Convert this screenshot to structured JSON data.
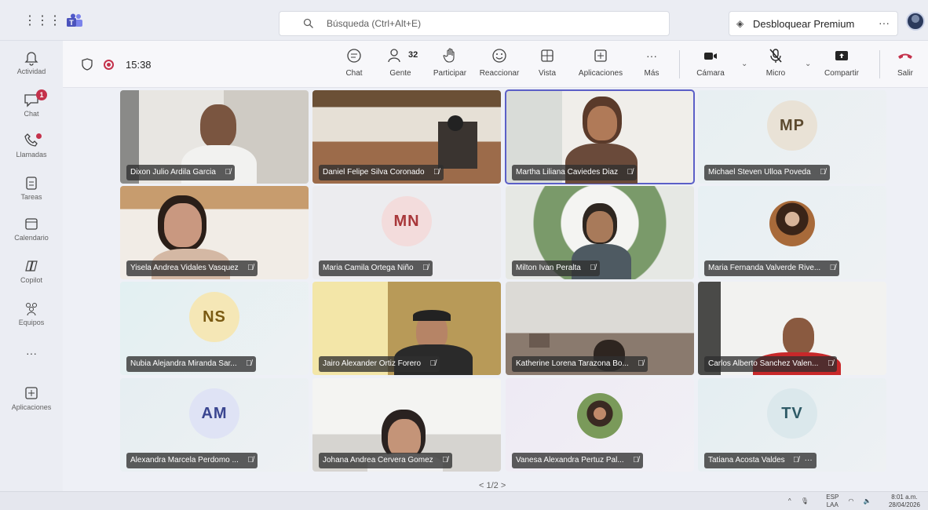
{
  "search": {
    "placeholder": "Búsqueda (Ctrl+Alt+E)"
  },
  "premium": {
    "label": "Desbloquear Premium",
    "more": "···"
  },
  "rail": [
    {
      "label": "Actividad",
      "icon": "bell-icon"
    },
    {
      "label": "Chat",
      "icon": "chat-icon",
      "badge": "1"
    },
    {
      "label": "Llamadas",
      "icon": "phone-icon",
      "dot": true
    },
    {
      "label": "Tareas",
      "icon": "tasks-icon"
    },
    {
      "label": "Calendario",
      "icon": "calendar-icon"
    },
    {
      "label": "Copilot",
      "icon": "copilot-icon"
    },
    {
      "label": "Equipos",
      "icon": "teams-icon"
    },
    {
      "label": "···",
      "icon": "more-icon"
    },
    {
      "label": "Aplicaciones",
      "icon": "add-app-icon"
    }
  ],
  "meeting": {
    "time": "15:38",
    "participants_count": "32",
    "toolbar": {
      "chat": "Chat",
      "people": "Gente",
      "raise": "Participar",
      "react": "Reaccionar",
      "view": "Vista",
      "apps": "Aplicaciones",
      "more": "Más",
      "camera": "Cámara",
      "mic": "Micro",
      "share": "Compartir",
      "leave": "Salir"
    }
  },
  "tiles": [
    {
      "name": "Dixon Julio Ardila Garcia",
      "type": "video"
    },
    {
      "name": "Daniel Felipe Silva Coronado",
      "type": "video"
    },
    {
      "name": "Martha Liliana Caviedes Diaz",
      "type": "video",
      "speaking": true
    },
    {
      "name": "Michael Steven Ulloa Poveda",
      "type": "initials",
      "initials": "MP"
    },
    {
      "name": "Yisela Andrea Vidales Vasquez",
      "type": "video"
    },
    {
      "name": "Maria Camila Ortega Niño",
      "type": "initials",
      "initials": "MN"
    },
    {
      "name": "Milton Ivan Peralta",
      "type": "video"
    },
    {
      "name": "Maria Fernanda Valverde Rive...",
      "type": "photo"
    },
    {
      "name": "Nubia Alejandra Miranda Sar...",
      "type": "initials",
      "initials": "NS"
    },
    {
      "name": "Jairo Alexander Ortiz Forero",
      "type": "video"
    },
    {
      "name": "Katherine Lorena Tarazona Bo...",
      "type": "video"
    },
    {
      "name": "Carlos Alberto Sanchez Valen...",
      "type": "video"
    },
    {
      "name": "Alexandra Marcela Perdomo ...",
      "type": "initials",
      "initials": "AM"
    },
    {
      "name": "Johana Andrea Cervera Gomez",
      "type": "video"
    },
    {
      "name": "Vanesa Alexandra Pertuz Pal...",
      "type": "photo"
    },
    {
      "name": "Tatiana Acosta Valdes",
      "type": "initials",
      "initials": "TV",
      "more": "···"
    }
  ],
  "pager": {
    "text": "< 1/2 >"
  },
  "tray": {
    "lang_top": "ESP",
    "lang_bottom": "LAA",
    "time": "8:01 a.m.",
    "date": "28/04/2026",
    "caret": "^"
  },
  "colors": {
    "accent": "#5b5fc7",
    "leave": "#c4314b",
    "badge": "#c4314b"
  }
}
